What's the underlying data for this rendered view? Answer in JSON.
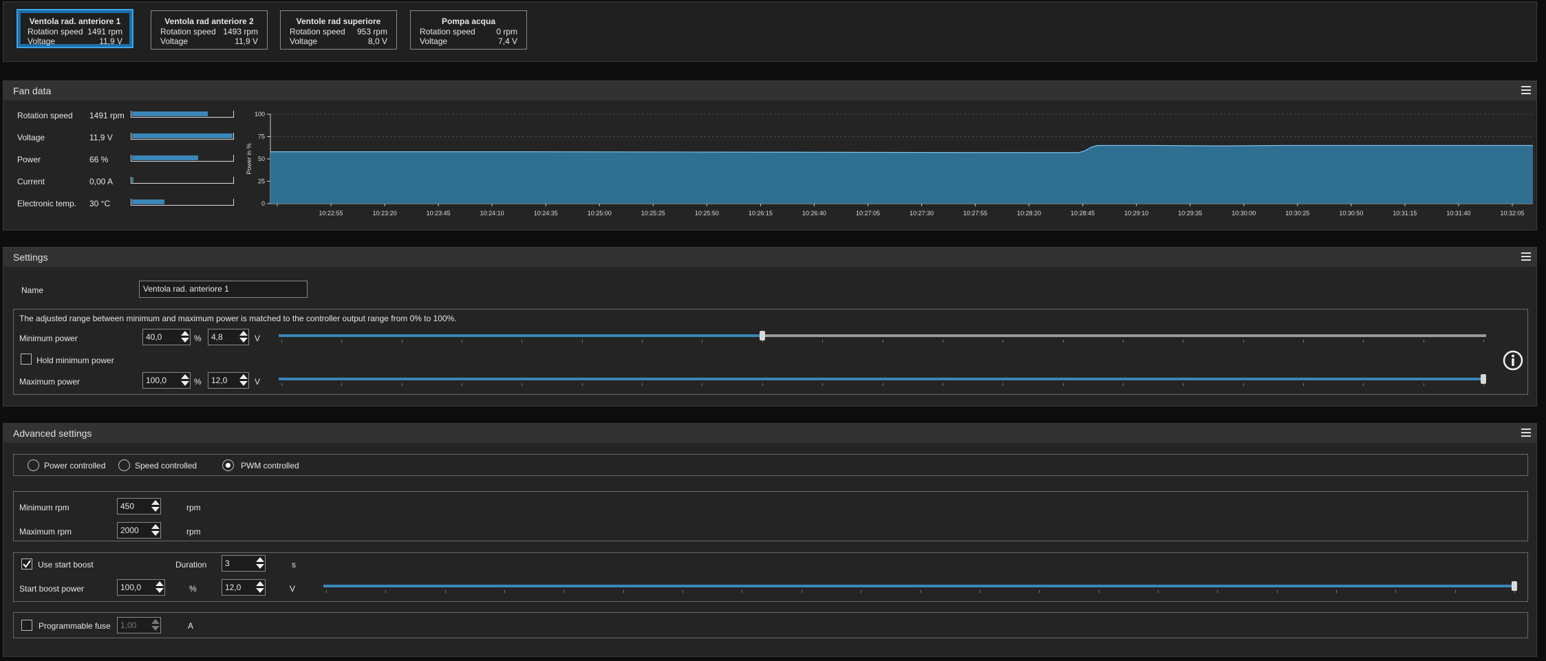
{
  "fans": [
    {
      "name": "Ventola rad. anteriore 1",
      "speed_label": "Rotation speed",
      "speed": "1491 rpm",
      "voltage_label": "Voltage",
      "voltage": "11,9 V",
      "selected": true
    },
    {
      "name": "Ventola rad anteriore 2",
      "speed_label": "Rotation speed",
      "speed": "1493 rpm",
      "voltage_label": "Voltage",
      "voltage": "11,9 V",
      "selected": false
    },
    {
      "name": "Ventole rad superiore",
      "speed_label": "Rotation speed",
      "speed": "953 rpm",
      "voltage_label": "Voltage",
      "voltage": "8,0 V",
      "selected": false
    },
    {
      "name": "Pompa acqua",
      "speed_label": "Rotation speed",
      "speed": "0 rpm",
      "voltage_label": "Voltage",
      "voltage": "7,4 V",
      "selected": false
    }
  ],
  "fan_data": {
    "title": "Fan data",
    "rows": [
      {
        "label": "Rotation speed",
        "value": "1491 rpm",
        "level": 0.75
      },
      {
        "label": "Voltage",
        "value": "11,9 V",
        "level": 1.0
      },
      {
        "label": "Power",
        "value": "66 %",
        "level": 0.66
      },
      {
        "label": "Current",
        "value": "0,00 A",
        "level": 0.01
      },
      {
        "label": "Electronic temp.",
        "value": "30 °C",
        "level": 0.32
      }
    ],
    "chart_title": "Power in %"
  },
  "chart_data": {
    "type": "area",
    "ylabel": "Power in %",
    "ylim": [
      0,
      100
    ],
    "yticks": [
      "100",
      "75",
      "50",
      "25",
      "0"
    ],
    "xticks": [
      "10:22:55",
      "10:23:20",
      "10:23:45",
      "10:24:10",
      "10:24:35",
      "10:25:00",
      "10:25:25",
      "10:25:50",
      "10:26:15",
      "10:26:40",
      "10:27:05",
      "10:27:30",
      "10:27:55",
      "10:28:20",
      "10:28:45",
      "10:29:10",
      "10:29:35",
      "10:30:00",
      "10:30:25",
      "10:30:50",
      "10:31:15",
      "10:31:40",
      "10:32:05"
    ],
    "series": [
      {
        "points": [
          [
            0,
            58
          ],
          [
            0.2,
            58
          ],
          [
            0.4,
            57.5
          ],
          [
            0.6,
            57
          ],
          [
            0.64,
            57
          ],
          [
            0.645,
            59
          ],
          [
            0.65,
            63
          ],
          [
            0.655,
            65
          ],
          [
            0.66,
            65
          ],
          [
            0.7,
            65
          ],
          [
            0.75,
            64.5
          ],
          [
            0.8,
            65
          ],
          [
            0.9,
            65
          ],
          [
            1.0,
            65
          ]
        ]
      }
    ],
    "grid": true,
    "color": "#2f6f92"
  },
  "settings": {
    "title": "Settings",
    "name_label": "Name",
    "name_value": "Ventola rad. anteriore 1",
    "range_note": "The adjusted range between minimum and maximum power is matched to the controller output range from 0% to 100%.",
    "min_power_label": "Minimum power",
    "min_power_pct": "40,0",
    "min_power_v": "4,8",
    "min_power_level": 0.4,
    "hold_min_label": "Hold minimum power",
    "max_power_label": "Maximum power",
    "max_power_pct": "100,0",
    "max_power_v": "12,0",
    "max_power_level": 1.0,
    "pct_unit": "%",
    "v_unit": "V"
  },
  "advanced": {
    "title": "Advanced settings",
    "modes": [
      {
        "label": "Power controlled",
        "selected": false
      },
      {
        "label": "Speed controlled",
        "selected": false
      },
      {
        "label": "PWM controlled",
        "selected": true
      }
    ],
    "min_rpm_label": "Minimum rpm",
    "min_rpm": "450",
    "max_rpm_label": "Maximum rpm",
    "max_rpm": "2000",
    "rpm_unit": "rpm",
    "start_boost_label": "Use start boost",
    "start_boost_checked": true,
    "duration_label": "Duration",
    "duration": "3",
    "duration_unit": "s",
    "boost_power_label": "Start boost power",
    "boost_power_pct": "100,0",
    "boost_power_v": "12,0",
    "boost_level": 1.0,
    "pct_unit": "%",
    "v_unit": "V",
    "fuse_label": "Programmable fuse",
    "fuse_checked": false,
    "fuse_value": "1,00",
    "fuse_unit": "A"
  },
  "colors": {
    "accent": "#3a86b8",
    "selected_border": "#3fa3e6"
  }
}
